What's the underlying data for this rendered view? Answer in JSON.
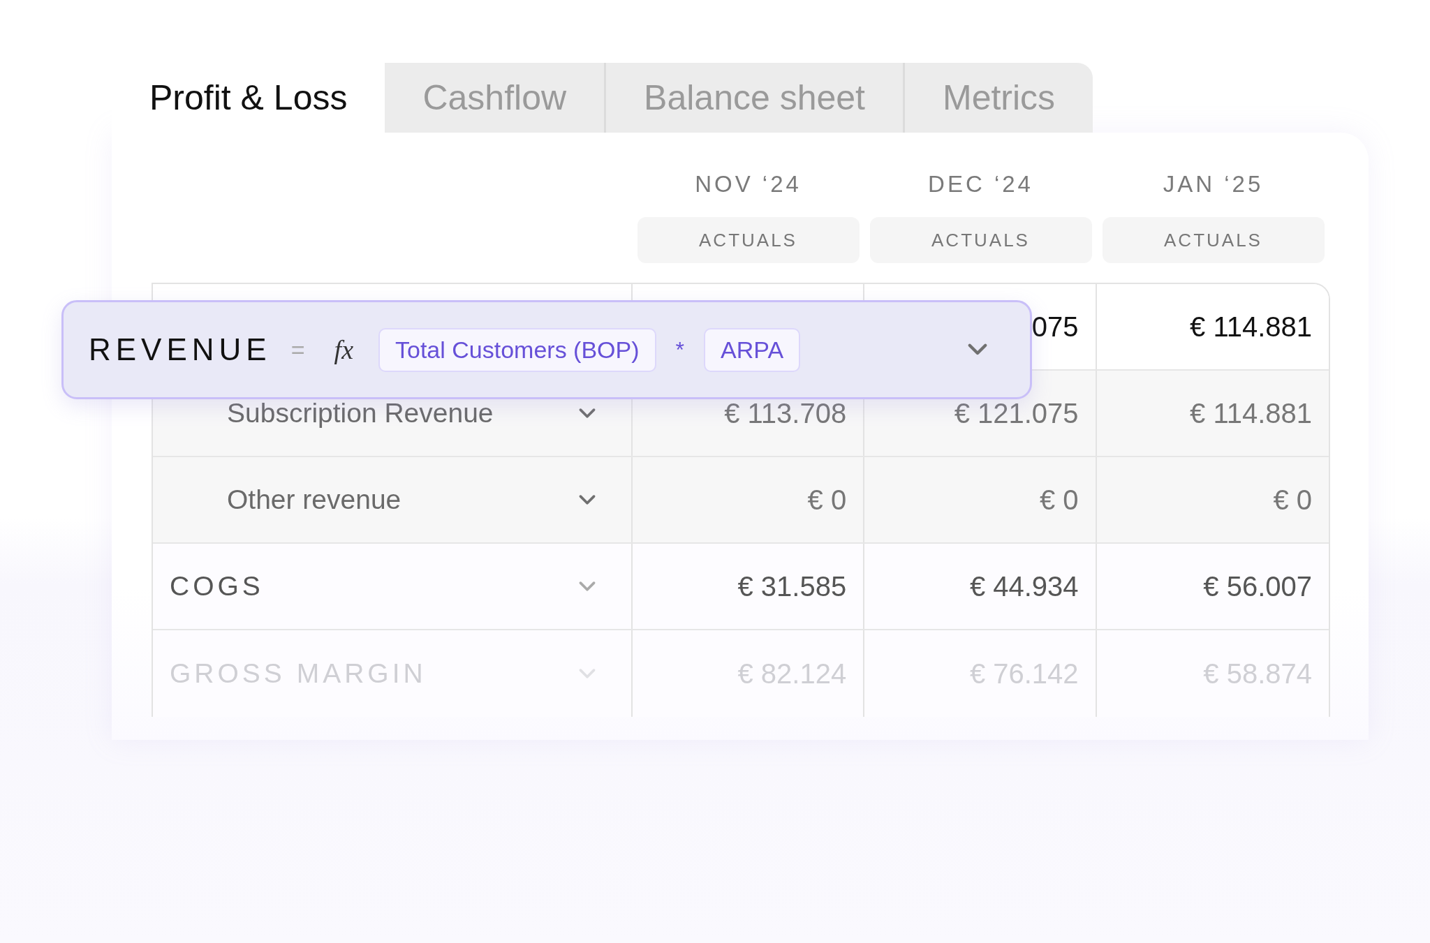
{
  "tabs": [
    {
      "label": "Profit & Loss",
      "selected": true
    },
    {
      "label": "Cashflow",
      "selected": false
    },
    {
      "label": "Balance sheet",
      "selected": false
    },
    {
      "label": "Metrics",
      "selected": false
    }
  ],
  "columns": [
    {
      "month": "NOV ‘24",
      "badge": "ACTUALS"
    },
    {
      "month": "DEC ‘24",
      "badge": "ACTUALS"
    },
    {
      "month": "JAN ‘25",
      "badge": "ACTUALS"
    }
  ],
  "formula": {
    "name": "REVENUE",
    "equals": "=",
    "fx": "fx",
    "terms": [
      "Total Customers (BOP)",
      "ARPA"
    ],
    "operator": "*"
  },
  "top_row": {
    "values": [
      "075",
      "€ 114.881"
    ]
  },
  "rows": [
    {
      "kind": "sub",
      "label": "Subscription Revenue",
      "faded": false,
      "values": [
        "€ 113.708",
        "€ 121.075",
        "€ 114.881"
      ]
    },
    {
      "kind": "sub",
      "label": "Other revenue",
      "faded": false,
      "values": [
        "€ 0",
        "€ 0",
        "€ 0"
      ]
    },
    {
      "kind": "section",
      "label": "COGS",
      "faded": false,
      "values": [
        "€ 31.585",
        "€ 44.934",
        "€ 56.007"
      ]
    },
    {
      "kind": "section",
      "label": "GROSS MARGIN",
      "faded": true,
      "values": [
        "€ 82.124",
        "€ 76.142",
        "€ 58.874"
      ]
    }
  ]
}
